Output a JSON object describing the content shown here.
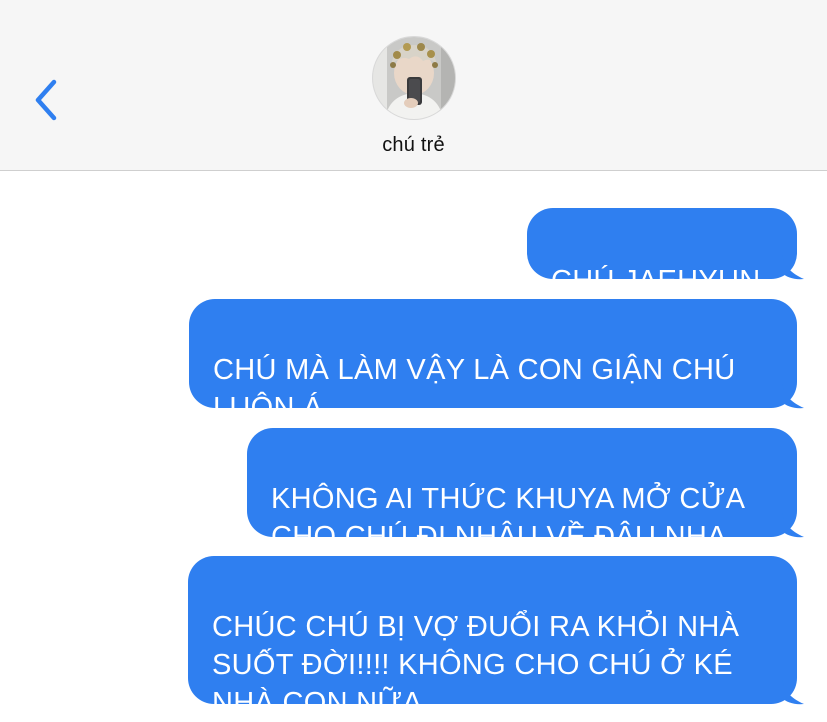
{
  "header": {
    "contact_name": "chú trẻ",
    "back_icon": "chevron-left-icon",
    "avatar": "contact-avatar-photo"
  },
  "colors": {
    "accent": "#2f7ff0",
    "header_bg": "#f6f6f6",
    "bubble_text": "#ffffff"
  },
  "messages": [
    {
      "from": "me",
      "text": "CHÚ JAEHYUN"
    },
    {
      "from": "me",
      "text": "CHÚ MÀ LÀM VẬY LÀ CON GIẬN CHÚ\nLUÔN Á"
    },
    {
      "from": "me",
      "text": "KHÔNG AI THỨC KHUYA MỞ CỬA\nCHO CHÚ ĐI NHẬU VỀ ĐÂU NHA"
    },
    {
      "from": "me",
      "text": "CHÚC CHÚ BỊ VỢ ĐUỔI RA KHỎI NHÀ\nSUỐT ĐỜI!!!! KHÔNG CHO CHÚ Ở KÉ\nNHÀ CON NỮA"
    }
  ]
}
